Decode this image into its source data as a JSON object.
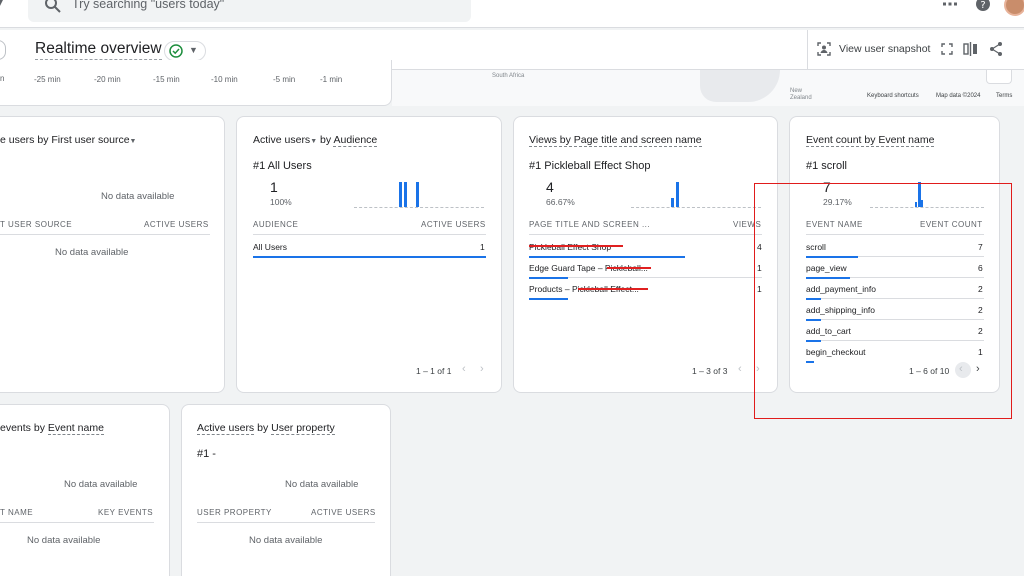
{
  "search": {
    "placeholder": "Try searching \"users today\""
  },
  "header": {
    "title": "Realtime overview",
    "view_snapshot": "View user snapshot"
  },
  "timeline": {
    "ticks": [
      "-25 min",
      "-20 min",
      "-15 min",
      "-10 min",
      "-5 min",
      "-1 min"
    ]
  },
  "map": {
    "labels": [
      "South Africa",
      "New Zealand"
    ],
    "keyboard": "Keyboard shortcuts",
    "mapdata": "Map data ©2024",
    "terms": "Terms"
  },
  "card_first_source": {
    "title_prefix": "e users by First user source",
    "no_data_top": "No data available",
    "col1": "T USER SOURCE",
    "col2": "ACTIVE USERS",
    "no_data": "No data available"
  },
  "card_audience": {
    "title_a": "Active users",
    "title_b": "by",
    "title_c": "Audience",
    "top_label": "#1  All Users",
    "top_value": "1",
    "top_pct": "100%",
    "col1": "AUDIENCE",
    "col2": "ACTIVE USERS",
    "rows": [
      {
        "label": "All Users",
        "value": "1"
      }
    ],
    "pagination": "1 – 1 of 1"
  },
  "card_views": {
    "title": "Views by Page title and screen name",
    "top_label": "#1  Pickleball Effect Shop",
    "top_value": "4",
    "top_pct": "66.67%",
    "col1": "PAGE TITLE AND SCREEN ...",
    "col2": "VIEWS",
    "rows": [
      {
        "label": "Pickleball Effect Shop",
        "value": "4"
      },
      {
        "label": "Edge Guard Tape – Pickleball...",
        "value": "1"
      },
      {
        "label": "Products – Pickleball Effect...",
        "value": "1"
      }
    ],
    "pagination": "1 – 3 of 3"
  },
  "card_events": {
    "title": "Event count by Event name",
    "top_label": "#1  scroll",
    "top_value": "7",
    "top_pct": "29.17%",
    "col1": "EVENT NAME",
    "col2": "EVENT COUNT",
    "rows": [
      {
        "label": "scroll",
        "value": "7"
      },
      {
        "label": "page_view",
        "value": "6"
      },
      {
        "label": "add_payment_info",
        "value": "2"
      },
      {
        "label": "add_shipping_info",
        "value": "2"
      },
      {
        "label": "add_to_cart",
        "value": "2"
      },
      {
        "label": "begin_checkout",
        "value": "1"
      }
    ],
    "pagination": "1 – 6 of 10"
  },
  "card_key_events": {
    "title_prefix": "events by",
    "title_suffix": "Event name",
    "no_data_top": "No data available",
    "col1": "T NAME",
    "col2": "KEY EVENTS",
    "no_data": "No data available"
  },
  "card_user_property": {
    "title_a": "Active users",
    "title_b": "by",
    "title_c": "User property",
    "top_label": "#1  -",
    "no_data_top": "No data available",
    "col1": "USER PROPERTY",
    "col2": "ACTIVE USERS",
    "no_data": "No data available"
  },
  "colors": {
    "accent": "#1a73e8",
    "annotation": "#e01b1b",
    "ok": "#1e8e3e"
  }
}
